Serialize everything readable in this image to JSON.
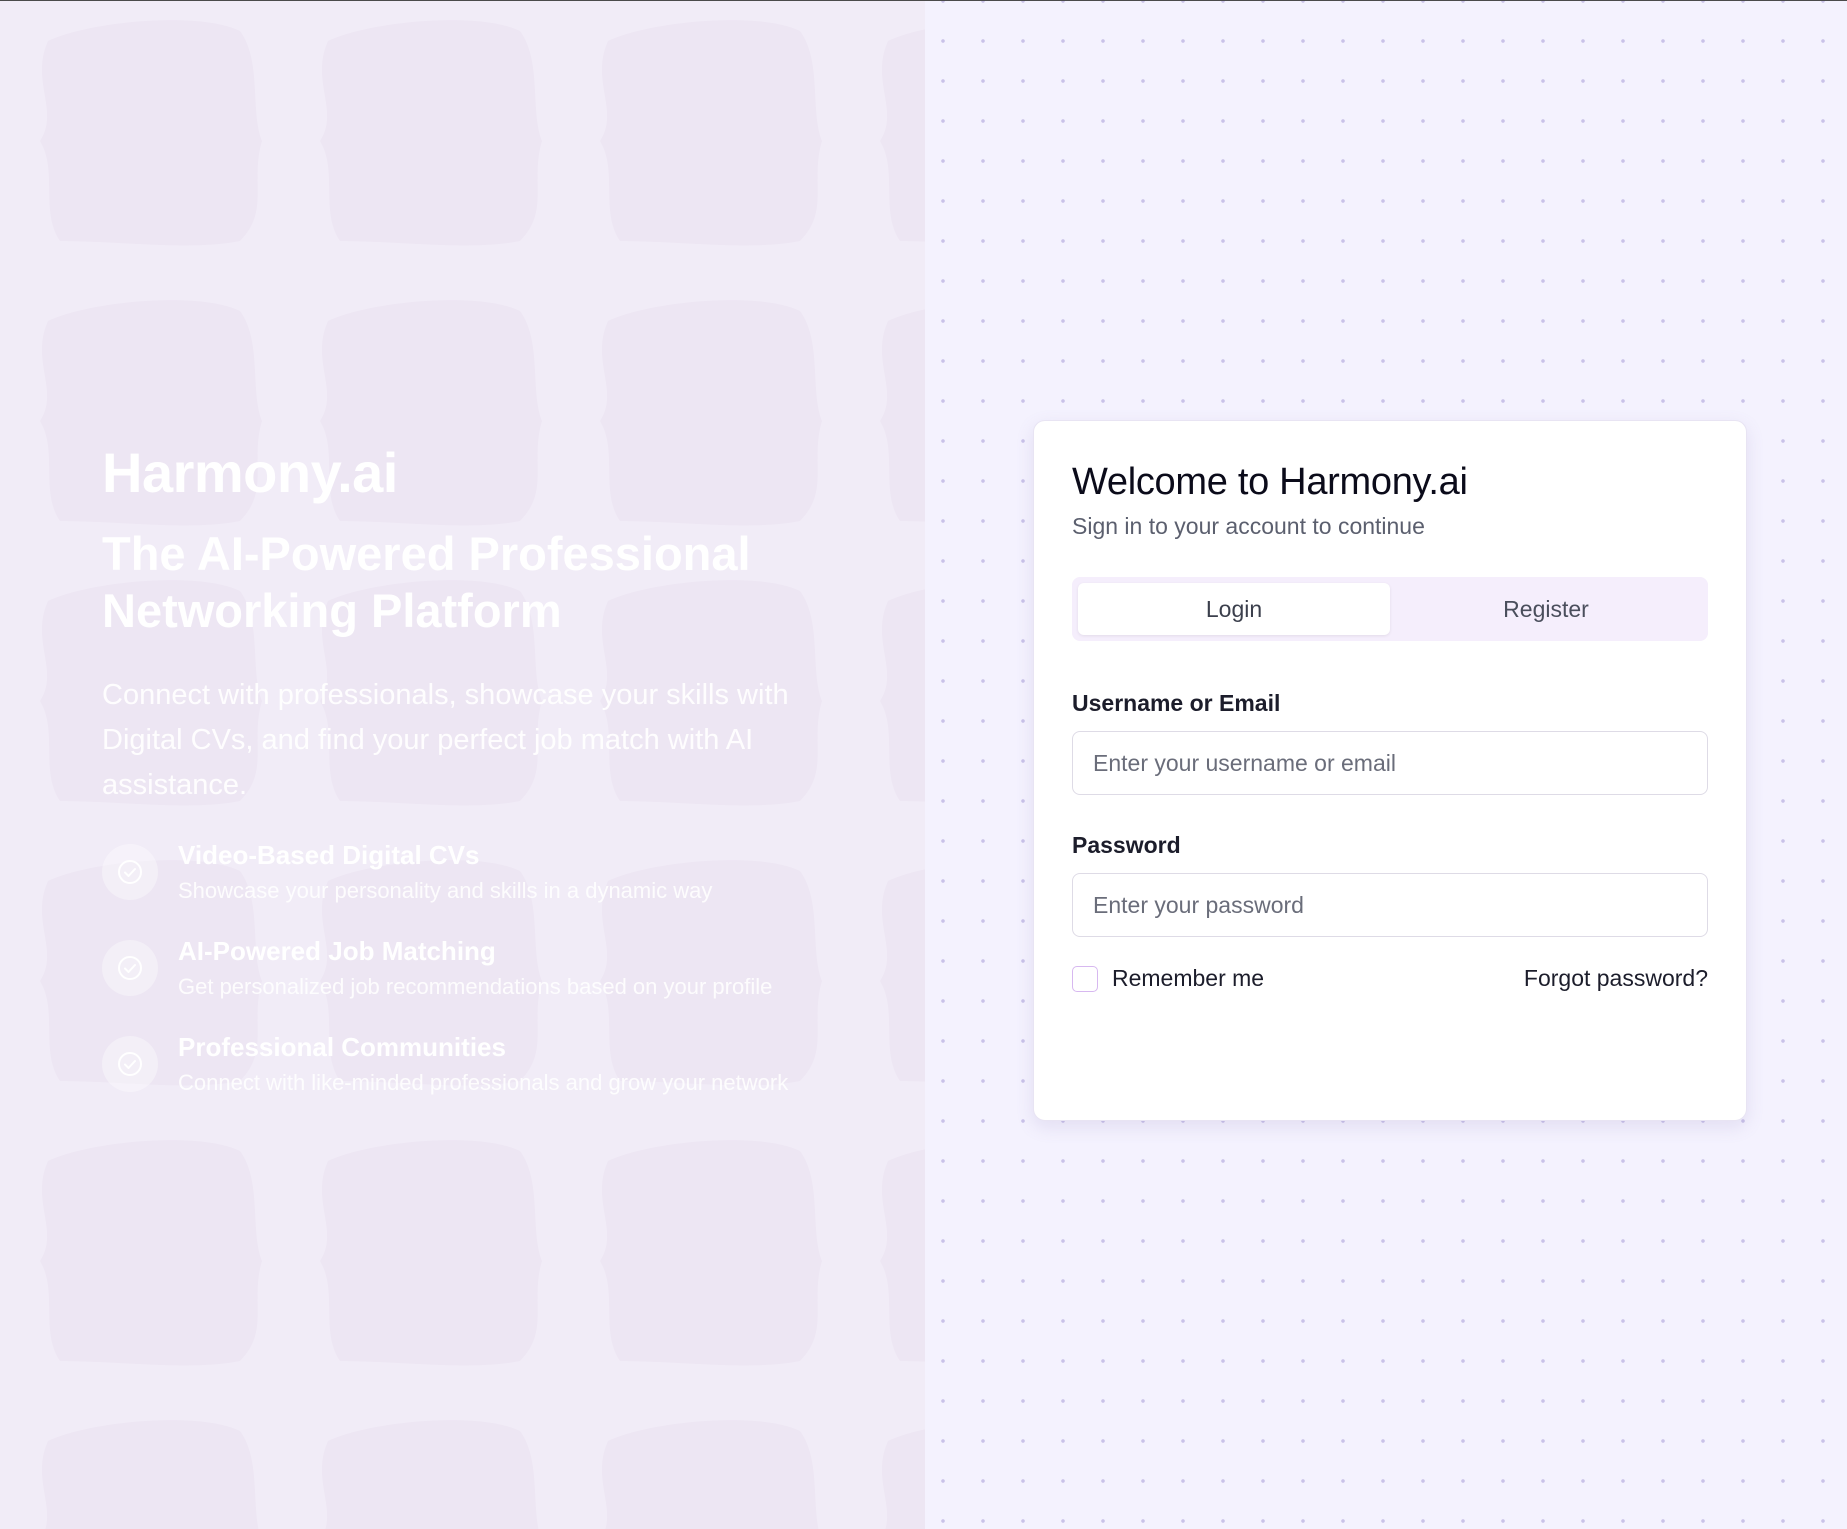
{
  "hero": {
    "brand": "Harmony.ai",
    "tagline": "The AI-Powered Professional Networking Platform",
    "description": "Connect with professionals, showcase your skills with Digital CVs, and find your perfect job match with AI assistance.",
    "features": [
      {
        "title": "Video-Based Digital CVs",
        "description": "Showcase your personality and skills in a dynamic way",
        "icon": "check-circle-icon"
      },
      {
        "title": "AI-Powered Job Matching",
        "description": "Get personalized job recommendations based on your profile",
        "icon": "check-circle-icon"
      },
      {
        "title": "Professional Communities",
        "description": "Connect with like-minded professionals and grow your network",
        "icon": "check-circle-icon"
      }
    ]
  },
  "auth": {
    "title": "Welcome to Harmony.ai",
    "subtitle": "Sign in to your account to continue",
    "tabs": [
      {
        "label": "Login",
        "active": true
      },
      {
        "label": "Register",
        "active": false
      }
    ],
    "username": {
      "label": "Username or Email",
      "placeholder": "Enter your username or email",
      "value": ""
    },
    "password": {
      "label": "Password",
      "placeholder": "Enter your password",
      "value": ""
    },
    "remember_label": "Remember me",
    "remember_checked": false,
    "forgot_label": "Forgot password?"
  },
  "colors": {
    "hero_bg": "#f1ecf7",
    "right_bg": "#f4f2fe",
    "tab_bg": "#f5eefc",
    "checkbox_border": "#d7b8f0"
  }
}
